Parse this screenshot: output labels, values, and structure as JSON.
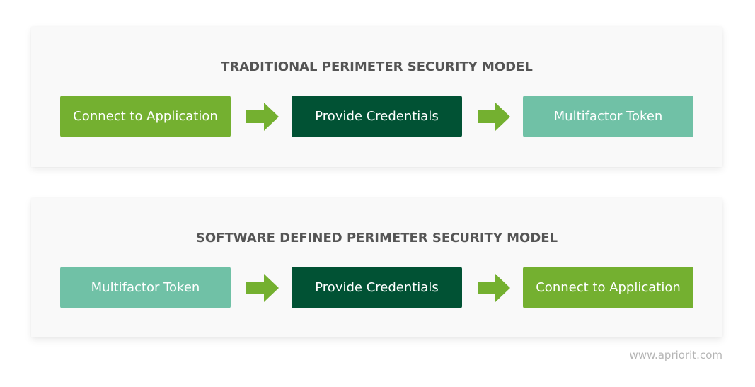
{
  "colors": {
    "lime_green": "#74b030",
    "dark_green": "#015234",
    "teal_green": "#70c1a6",
    "arrow_green": "#74b030",
    "title_gray": "#555555",
    "footer_gray": "#b4b4b4"
  },
  "models": [
    {
      "title": "TRADITIONAL PERIMETER SECURITY MODEL",
      "steps": [
        {
          "label": "Connect to Application",
          "color": "#74b030"
        },
        {
          "label": "Provide Credentials",
          "color": "#015234"
        },
        {
          "label": "Multifactor Token",
          "color": "#70c1a6"
        }
      ],
      "arrows": [
        "arrow-right-icon",
        "arrow-right-icon"
      ]
    },
    {
      "title": "SOFTWARE DEFINED PERIMETER SECURITY MODEL",
      "steps": [
        {
          "label": "Multifactor Token",
          "color": "#70c1a6"
        },
        {
          "label": "Provide Credentials",
          "color": "#015234"
        },
        {
          "label": "Connect to Application",
          "color": "#74b030"
        }
      ],
      "arrows": [
        "arrow-right-icon",
        "arrow-right-icon"
      ]
    }
  ],
  "footer": {
    "url": "www.apriorit.com"
  }
}
